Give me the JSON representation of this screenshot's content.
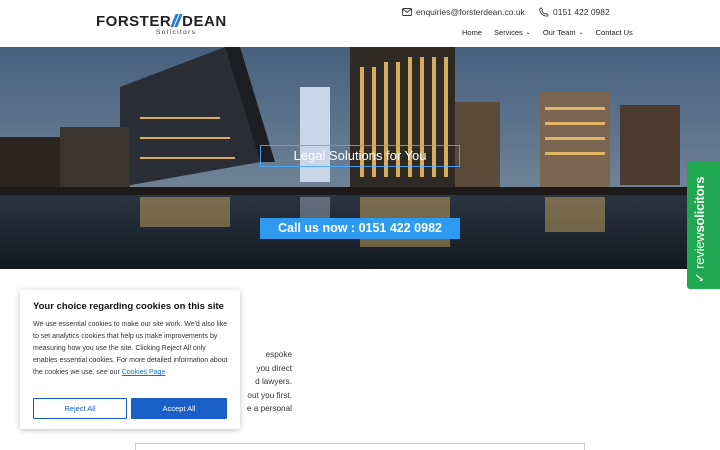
{
  "header": {
    "logo_main_left": "FORSTER",
    "logo_main_right": "DEAN",
    "logo_sub": "Solicitors",
    "email": "enquiries@forsterdean.co.uk",
    "phone": "0151 422 0982",
    "nav": [
      {
        "label": "Home",
        "has_dropdown": false
      },
      {
        "label": "Services",
        "has_dropdown": true
      },
      {
        "label": "Our Team",
        "has_dropdown": true
      },
      {
        "label": "Contact Us",
        "has_dropdown": false
      }
    ],
    "icons": {
      "email": "envelope-icon",
      "phone": "phone-icon",
      "dropdown": "chevron-down-icon"
    }
  },
  "hero": {
    "title": "Legal Solutions for You",
    "cta_prefix": "Call us now :",
    "cta_number": "0151 422 0982",
    "cta_color": "#2e9bf0"
  },
  "review_badge": {
    "text_light": "review",
    "text_bold": "solicitors",
    "color": "#1fa84f",
    "icon": "checkmark-icon"
  },
  "body_fragments": [
    "espoke",
    "you direct",
    "d lawyers.",
    "out you first.",
    "e a personal"
  ],
  "cookie": {
    "title": "Your choice regarding cookies on this site",
    "body": "We use essential cookies to make our site work. We'd also like to set analytics cookies that help us make improvements by measuring how you use the site. Clicking Reject All only enables essential cookies. For more detailed information about the cookies we use, see our",
    "link": "Cookies Page",
    "reject_label": "Reject All",
    "accept_label": "Accept All",
    "accent": "#1a5fc7"
  }
}
